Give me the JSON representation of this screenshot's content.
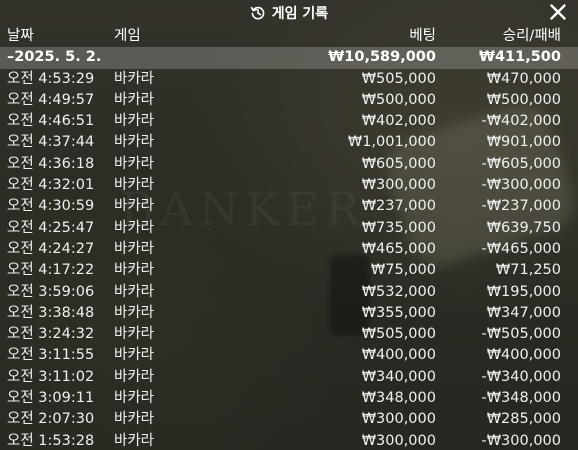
{
  "title": "게임 기록",
  "icons": {
    "history": "history-icon",
    "close": "close-icon"
  },
  "background_text": "BANKER",
  "columns": {
    "date": "날짜",
    "game": "게임",
    "bet": "베팅",
    "winloss": "승리/패배"
  },
  "summary": {
    "date": "–2025. 5. 2.",
    "bet": "₩10,589,000",
    "winloss": "₩411,500"
  },
  "rows": [
    {
      "time": "오전 4:53:29",
      "game": "바카라",
      "bet": "₩505,000",
      "winloss": "₩470,000"
    },
    {
      "time": "오전 4:49:57",
      "game": "바카라",
      "bet": "₩500,000",
      "winloss": "₩500,000"
    },
    {
      "time": "오전 4:46:51",
      "game": "바카라",
      "bet": "₩402,000",
      "winloss": "-₩402,000"
    },
    {
      "time": "오전 4:37:44",
      "game": "바카라",
      "bet": "₩1,001,000",
      "winloss": "₩901,000"
    },
    {
      "time": "오전 4:36:18",
      "game": "바카라",
      "bet": "₩605,000",
      "winloss": "-₩605,000"
    },
    {
      "time": "오전 4:32:01",
      "game": "바카라",
      "bet": "₩300,000",
      "winloss": "-₩300,000"
    },
    {
      "time": "오전 4:30:59",
      "game": "바카라",
      "bet": "₩237,000",
      "winloss": "-₩237,000"
    },
    {
      "time": "오전 4:25:47",
      "game": "바카라",
      "bet": "₩735,000",
      "winloss": "₩639,750"
    },
    {
      "time": "오전 4:24:27",
      "game": "바카라",
      "bet": "₩465,000",
      "winloss": "-₩465,000"
    },
    {
      "time": "오전 4:17:22",
      "game": "바카라",
      "bet": "₩75,000",
      "winloss": "₩71,250"
    },
    {
      "time": "오전 3:59:06",
      "game": "바카라",
      "bet": "₩532,000",
      "winloss": "₩195,000"
    },
    {
      "time": "오전 3:38:48",
      "game": "바카라",
      "bet": "₩355,000",
      "winloss": "₩347,000"
    },
    {
      "time": "오전 3:24:32",
      "game": "바카라",
      "bet": "₩505,000",
      "winloss": "-₩505,000"
    },
    {
      "time": "오전 3:11:55",
      "game": "바카라",
      "bet": "₩400,000",
      "winloss": "₩400,000"
    },
    {
      "time": "오전 3:11:02",
      "game": "바카라",
      "bet": "₩340,000",
      "winloss": "-₩340,000"
    },
    {
      "time": "오전 3:09:11",
      "game": "바카라",
      "bet": "₩348,000",
      "winloss": "-₩348,000"
    },
    {
      "time": "오전 2:07:30",
      "game": "바카라",
      "bet": "₩300,000",
      "winloss": "₩285,000"
    },
    {
      "time": "오전 1:53:28",
      "game": "바카라",
      "bet": "₩300,000",
      "winloss": "-₩300,000"
    }
  ]
}
